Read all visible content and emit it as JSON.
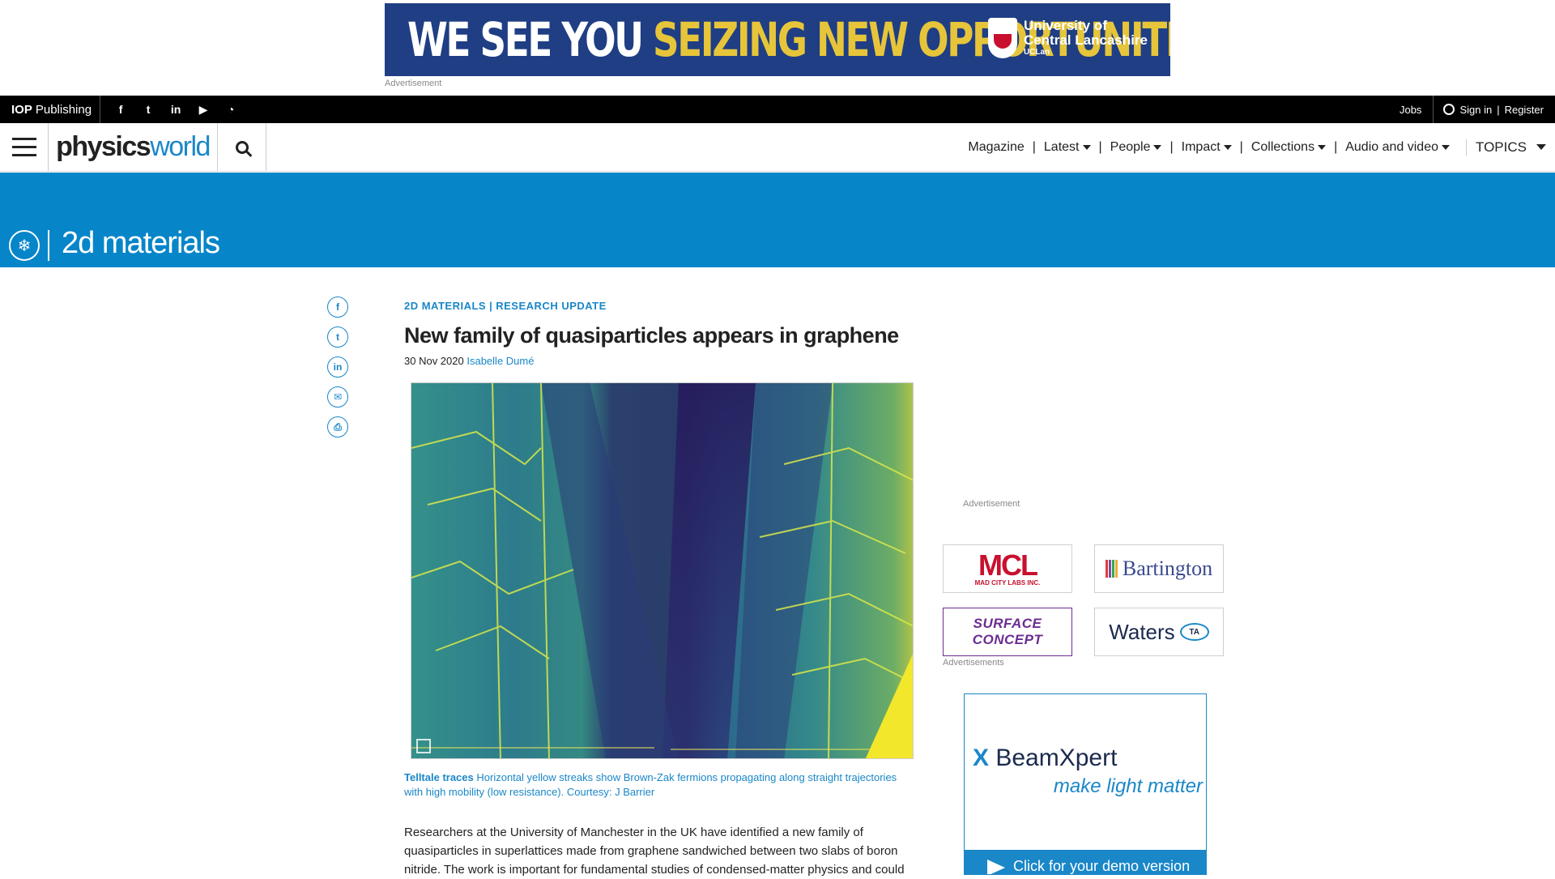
{
  "top_ad": {
    "slogan_white": "WE SEE YOU",
    "slogan_yellow": "SEIZING NEW OPPORTUNITIES",
    "logo_line1": "University of",
    "logo_line2": "Central Lancashire",
    "logo_line3": "UCLan",
    "caption": "Advertisement"
  },
  "utility_bar": {
    "publisher_bold": "IOP",
    "publisher": "Publishing",
    "social_icons": [
      "facebook-icon",
      "twitter-icon",
      "linkedin-icon",
      "youtube-icon",
      "rss-icon"
    ],
    "jobs": "Jobs",
    "sign_in": "Sign in",
    "separator": "|",
    "register": "Register"
  },
  "nav": {
    "brand_part1": "physics",
    "brand_part2": "world",
    "items": [
      {
        "label": "Magazine",
        "dropdown": false
      },
      {
        "label": "Latest",
        "dropdown": true
      },
      {
        "label": "People",
        "dropdown": true
      },
      {
        "label": "Impact",
        "dropdown": true
      },
      {
        "label": "Collections",
        "dropdown": true
      },
      {
        "label": "Audio and video",
        "dropdown": true
      }
    ],
    "separator": "|",
    "topics": "TOPICS"
  },
  "band": {
    "title": "2d materials",
    "accent": "#0685c9"
  },
  "share_icons": [
    "facebook-icon",
    "twitter-icon",
    "linkedin-icon",
    "email-icon",
    "print-icon"
  ],
  "article": {
    "kicker_1": "2D MATERIALS",
    "kicker_sep": "|",
    "kicker_2": "RESEARCH UPDATE",
    "headline": "New family of quasiparticles appears in graphene",
    "date": "30 Nov 2020",
    "author": "Isabelle Dumé",
    "caption_title": "Telltale traces",
    "caption_text": "Horizontal yellow streaks show Brown-Zak fermions propagating along straight trajectories with high mobility (low resistance). Courtesy: J Barrier",
    "body": "Researchers at the University of Manchester in the UK have identified a new family of quasiparticles in superlattices made from graphene sandwiched between two slabs of boron nitride. The work is important for fundamental studies of condensed-matter physics and could"
  },
  "right_column": {
    "ad_label": "Advertisement",
    "sponsors_label": "Advertisements",
    "sponsors": {
      "mcl_big": "MCL",
      "mcl_small": "MAD CITY LABS INC.",
      "bartington": "Bartington",
      "surface_1": "SURFACE",
      "surface_2": "CONCEPT",
      "waters": "Waters",
      "ta": "TA"
    },
    "beam_ad": {
      "logo_x": "X",
      "logo": "BeamXpert",
      "tagline": "make light matter",
      "cta": "Click for your demo version"
    }
  },
  "colors": {
    "brand_blue": "#1a87c8",
    "ad_navy": "#1f3e84",
    "ad_yellow": "#e6c53a"
  }
}
